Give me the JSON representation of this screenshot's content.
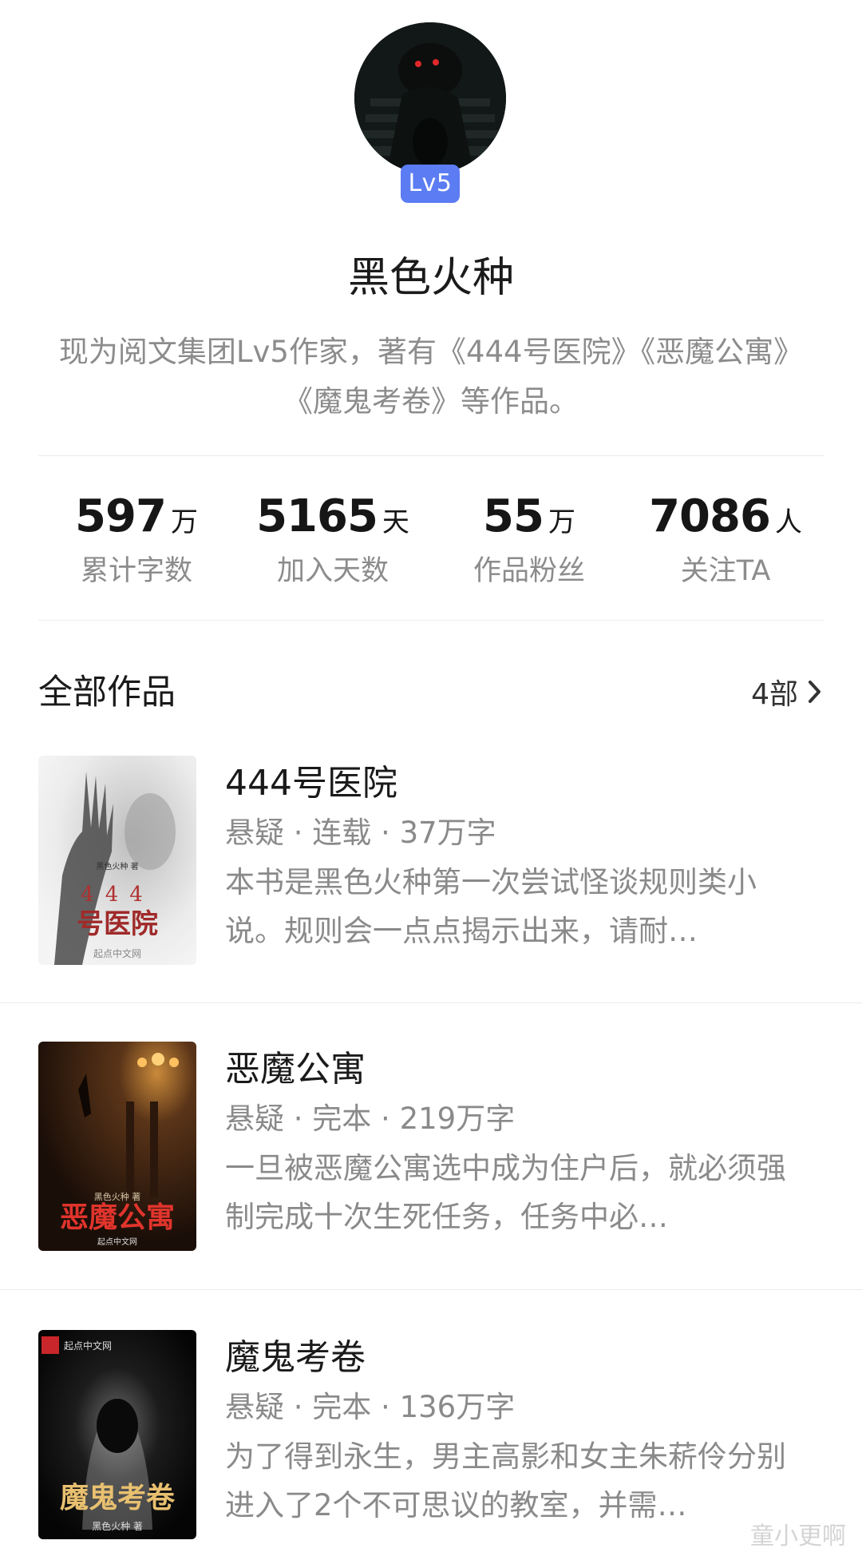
{
  "profile": {
    "level": "Lv5",
    "name": "黑色火种",
    "intro": "现为阅文集团Lv5作家，著有《444号医院》《恶魔公寓》《魔鬼考卷》等作品。"
  },
  "stats": [
    {
      "value": "597",
      "unit": "万",
      "label": "累计字数"
    },
    {
      "value": "5165",
      "unit": "天",
      "label": "加入天数"
    },
    {
      "value": "55",
      "unit": "万",
      "label": "作品粉丝"
    },
    {
      "value": "7086",
      "unit": "人",
      "label": "关注TA"
    }
  ],
  "works": {
    "title": "全部作品",
    "count": "4部",
    "books": [
      {
        "title": "444号医院",
        "meta": "悬疑 · 连载 · 37万字",
        "desc": "本书是黑色火种第一次尝试怪谈规则类小说。规则会一点点揭示出来，请耐…",
        "cover_text": "444号医院",
        "cover_author": "黑色火种 著",
        "cover_publisher": "起点中文网"
      },
      {
        "title": "恶魔公寓",
        "meta": "悬疑 · 完本 · 219万字",
        "desc": "一旦被恶魔公寓选中成为住户后，就必须强制完成十次生死任务，任务中必…",
        "cover_text": "恶魔公寓",
        "cover_author": "黑色火种 著",
        "cover_publisher": "起点中文网"
      },
      {
        "title": "魔鬼考卷",
        "meta": "悬疑 · 完本 · 136万字",
        "desc": "为了得到永生，男主高影和女主朱菥伶分别进入了2个不可思议的教室，并需…",
        "cover_text": "魔鬼考卷",
        "cover_author": "黑色火种 著",
        "cover_publisher": "起点中文网"
      }
    ]
  },
  "watermark": "童小更啊",
  "colors": {
    "level_badge": "#5b7cf2",
    "muted_text": "#8a8a8a",
    "divider": "#ececec"
  }
}
